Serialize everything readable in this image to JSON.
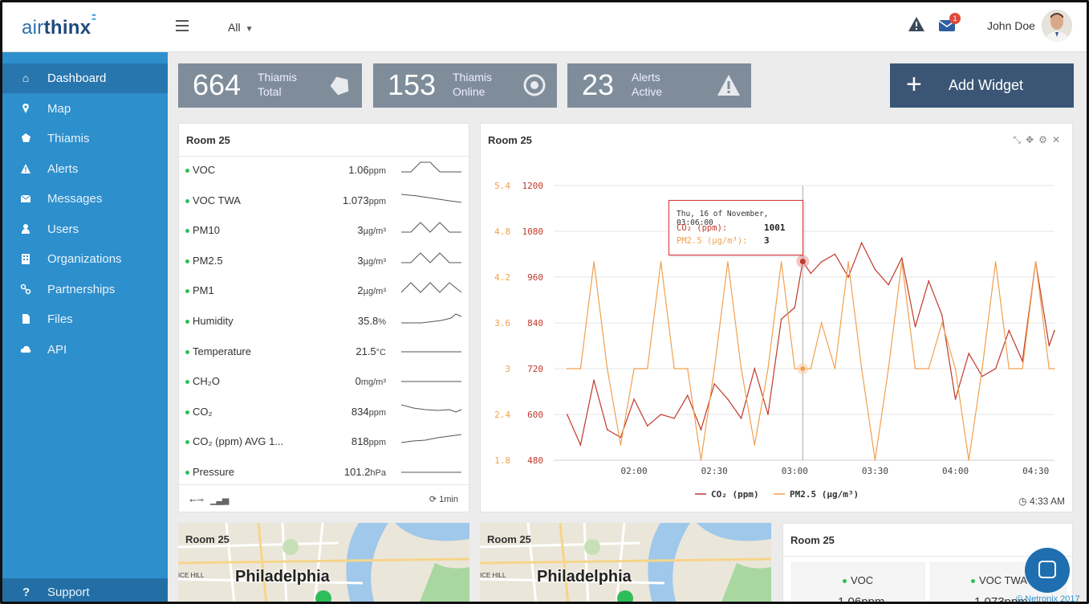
{
  "header": {
    "logo": {
      "air": "air",
      "thinx": "thinx"
    },
    "filter": "All",
    "mail_badge": "1",
    "user_name": "John Doe"
  },
  "sidebar": {
    "items": [
      {
        "label": "Dashboard",
        "icon": "home-icon",
        "active": true
      },
      {
        "label": "Map",
        "icon": "map-marker-icon"
      },
      {
        "label": "Thiamis",
        "icon": "device-icon"
      },
      {
        "label": "Alerts",
        "icon": "warning-icon"
      },
      {
        "label": "Messages",
        "icon": "envelope-icon"
      },
      {
        "label": "Users",
        "icon": "user-icon"
      },
      {
        "label": "Organizations",
        "icon": "building-icon"
      },
      {
        "label": "Partnerships",
        "icon": "link-icon"
      },
      {
        "label": "Files",
        "icon": "file-icon"
      },
      {
        "label": "API",
        "icon": "cloud-icon"
      }
    ],
    "support": "Support"
  },
  "stats": [
    {
      "value": "664",
      "line1": "Thiamis",
      "line2": "Total",
      "icon": "device-icon"
    },
    {
      "value": "153",
      "line1": "Thiamis",
      "line2": "Online",
      "icon": "target-icon"
    },
    {
      "value": "23",
      "line1": "Alerts",
      "line2": "Active",
      "icon": "warning-icon"
    }
  ],
  "add_widget": "Add Widget",
  "sensor_panel": {
    "title": "Room 25",
    "rows": [
      {
        "name": "VOC",
        "value": "1.06",
        "unit": "ppm"
      },
      {
        "name": "VOC TWA",
        "value": "1.073",
        "unit": "ppm"
      },
      {
        "name": "PM10",
        "value": "3",
        "unit": "µg/m³"
      },
      {
        "name": "PM2.5",
        "value": "3",
        "unit": "µg/m³"
      },
      {
        "name": "PM1",
        "value": "2",
        "unit": "µg/m³"
      },
      {
        "name": "Humidity",
        "value": "35.8",
        "unit": "%"
      },
      {
        "name": "Temperature",
        "value": "21.5",
        "unit": "°C"
      },
      {
        "name": "CH₂O",
        "value": "0",
        "unit": "mg/m³"
      },
      {
        "name": "CO₂",
        "value": "834",
        "unit": "ppm"
      },
      {
        "name": "CO₂ (ppm) AVG 1...",
        "value": "818",
        "unit": "ppm"
      },
      {
        "name": "Pressure",
        "value": "101.2",
        "unit": "hPa"
      }
    ],
    "refresh": "1min"
  },
  "chart_panel": {
    "title": "Room 25",
    "time": "4:33 AM",
    "tooltip": {
      "date": "Thu, 16 of November, 03:06:00",
      "co2_label": "CO₂ (ppm):",
      "co2_value": "1001",
      "pm_label": "PM2.5 (µg/m³):",
      "pm_value": "3"
    }
  },
  "chart_data": {
    "type": "line",
    "x_ticks": [
      "02:00",
      "02:30",
      "03:00",
      "03:30",
      "04:00",
      "04:30"
    ],
    "y_left_ticks": [
      480,
      600,
      720,
      840,
      960,
      1080,
      1200
    ],
    "y_left2_ticks": [
      1.8,
      2.4,
      3,
      3.6,
      4.2,
      4.8,
      5.4
    ],
    "ylim_left": [
      480,
      1200
    ],
    "ylim_left2": [
      1.8,
      5.4
    ],
    "series": [
      {
        "name": "CO₂ (ppm)",
        "color": "#c0392b",
        "axis": "left",
        "x_minutes": [
          95,
          100,
          105,
          110,
          115,
          120,
          125,
          130,
          135,
          140,
          145,
          150,
          155,
          160,
          165,
          170,
          175,
          180,
          183,
          186,
          190,
          195,
          200,
          205,
          210,
          215,
          220,
          225,
          230,
          235,
          240,
          245,
          250,
          255,
          260,
          265,
          270,
          275,
          277
        ],
        "values": [
          600,
          520,
          690,
          560,
          540,
          640,
          570,
          600,
          590,
          650,
          560,
          680,
          640,
          590,
          720,
          600,
          850,
          880,
          1001,
          970,
          1000,
          1020,
          960,
          1050,
          980,
          940,
          1010,
          830,
          950,
          860,
          640,
          760,
          700,
          720,
          820,
          740,
          1000,
          780,
          820
        ]
      },
      {
        "name": "PM2.5 (µg/m³)",
        "color": "#f0a050",
        "axis": "left2",
        "x_minutes": [
          95,
          100,
          105,
          110,
          115,
          120,
          125,
          130,
          135,
          140,
          145,
          150,
          155,
          160,
          165,
          170,
          175,
          180,
          183,
          186,
          190,
          195,
          200,
          205,
          210,
          215,
          220,
          225,
          230,
          235,
          240,
          245,
          250,
          255,
          260,
          265,
          270,
          275,
          277
        ],
        "values": [
          3,
          3,
          4.4,
          3,
          2,
          3,
          3,
          4.4,
          3,
          3,
          1.8,
          3,
          4.4,
          3,
          2,
          3,
          4.4,
          3,
          3,
          3,
          3.6,
          3,
          4.4,
          3,
          1.8,
          3,
          4.4,
          3,
          3,
          3.6,
          3,
          1.8,
          3,
          4.4,
          3,
          3,
          4.4,
          3,
          3
        ]
      }
    ],
    "legend": [
      "CO₂ (ppm)",
      "PM2.5 (µg/m³)"
    ],
    "legend_position": "bottom",
    "grid": true
  },
  "map_panels": [
    {
      "title": "Room 25",
      "city": "Philadelphia",
      "label": "ICE HILL"
    },
    {
      "title": "Room 25",
      "city": "Philadelphia",
      "label": "ICE HILL"
    }
  ],
  "tile_panel": {
    "title": "Room 25",
    "tiles": [
      {
        "name": "VOC",
        "value": "1.06ppm"
      },
      {
        "name": "VOC TWA",
        "value": "1.073ppm"
      }
    ]
  },
  "footer": {
    "copyright": "© Netronix 2017"
  }
}
